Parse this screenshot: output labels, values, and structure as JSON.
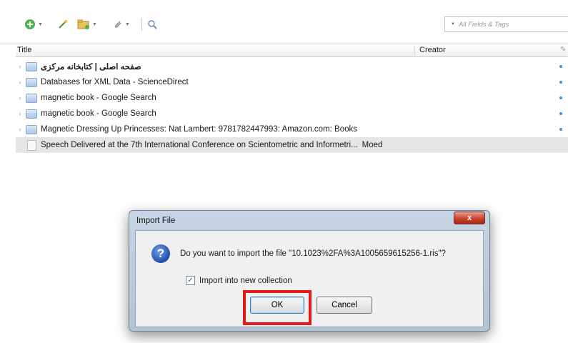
{
  "toolbar": {
    "new_item_icon": "green-plus-icon",
    "search_placeholder": "All Fields & Tags"
  },
  "columns": {
    "title": "Title",
    "creator": "Creator",
    "attachments_icon": "paperclip-icon"
  },
  "items": [
    {
      "title": "صفحه اصلی | کتابخانه مرکزی",
      "creator": "",
      "selected": false
    },
    {
      "title": "Databases for XML Data - ScienceDirect",
      "creator": "",
      "selected": false
    },
    {
      "title": "magnetic book - Google Search",
      "creator": "",
      "selected": false
    },
    {
      "title": "magnetic book - Google Search",
      "creator": "",
      "selected": false
    },
    {
      "title": "Magnetic Dressing Up Princesses: Nat Lambert: 9781782447993: Amazon.com: Books",
      "creator": "",
      "selected": false
    },
    {
      "title": "Speech Delivered at the 7th International Conference on Scientometric and Informetri...",
      "creator": "Moed",
      "selected": true
    }
  ],
  "dialog": {
    "title": "Import File",
    "close_label": "x",
    "message": "Do you want to import the file \"10.1023%2FA%3A1005659615256-1.ris\"?",
    "checkbox_label": "Import into new collection",
    "checkbox_checked": true,
    "ok_label": "OK",
    "cancel_label": "Cancel",
    "highlight_color": "#e21b1b"
  }
}
